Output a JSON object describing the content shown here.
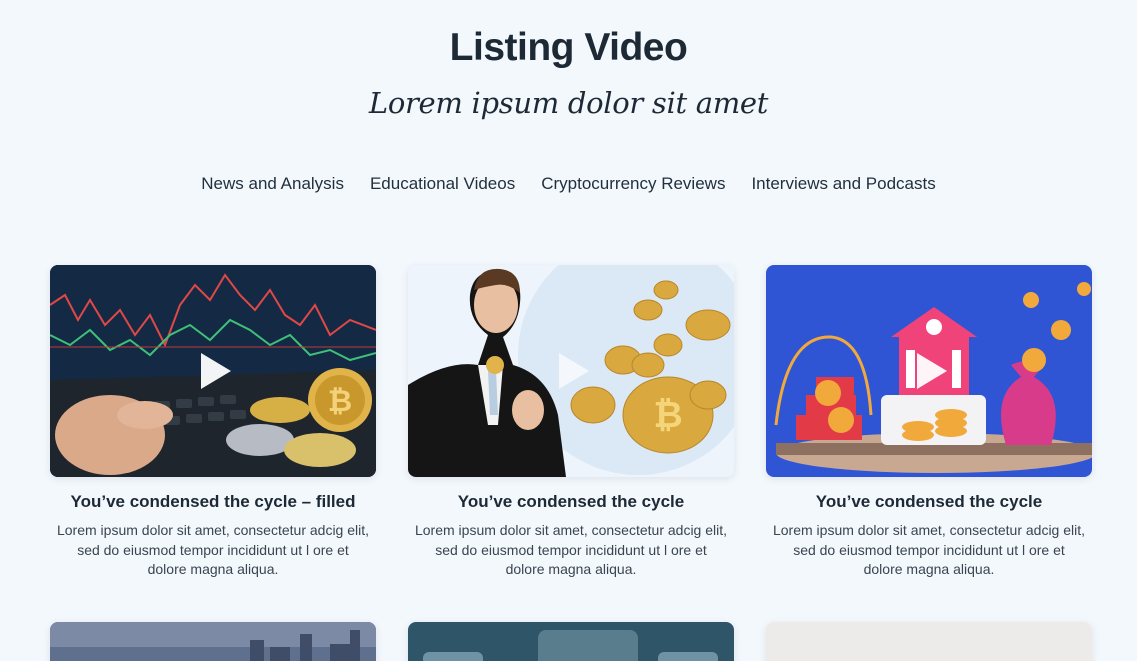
{
  "header": {
    "title": "Listing Video",
    "subtitle": "Lorem ipsum dolor sit amet"
  },
  "tabs": [
    {
      "label": "News and Analysis"
    },
    {
      "label": "Educational Videos"
    },
    {
      "label": "Cryptocurrency Reviews"
    },
    {
      "label": "Interviews and Podcasts"
    }
  ],
  "cards": [
    {
      "title": "You’ve condensed the cycle – filled",
      "description": "Lorem ipsum dolor sit amet, consectetur adcig elit, sed do eiusmod tempor incididunt ut l ore et dolore magna aliqua.",
      "thumbnail": "trading-laptop-coins-image"
    },
    {
      "title": "You’ve condensed the cycle",
      "description": "Lorem ipsum dolor sit amet, consectetur adcig elit, sed do eiusmod tempor incididunt ut l ore et dolore magna aliqua.",
      "thumbnail": "businessman-bitcoin-image"
    },
    {
      "title": "You’ve condensed the cycle",
      "description": "Lorem ipsum dolor sit amet, consectetur adcig elit, sed do eiusmod tempor incididunt ut l ore et dolore magna aliqua.",
      "thumbnail": "crypto-bank-3d-image"
    }
  ],
  "colors": {
    "background": "#f3f8fd",
    "text": "#1d2935",
    "bank_blue": "#2f55d4",
    "bank_pink": "#f0437a",
    "coin_gold": "#f2a93b"
  }
}
